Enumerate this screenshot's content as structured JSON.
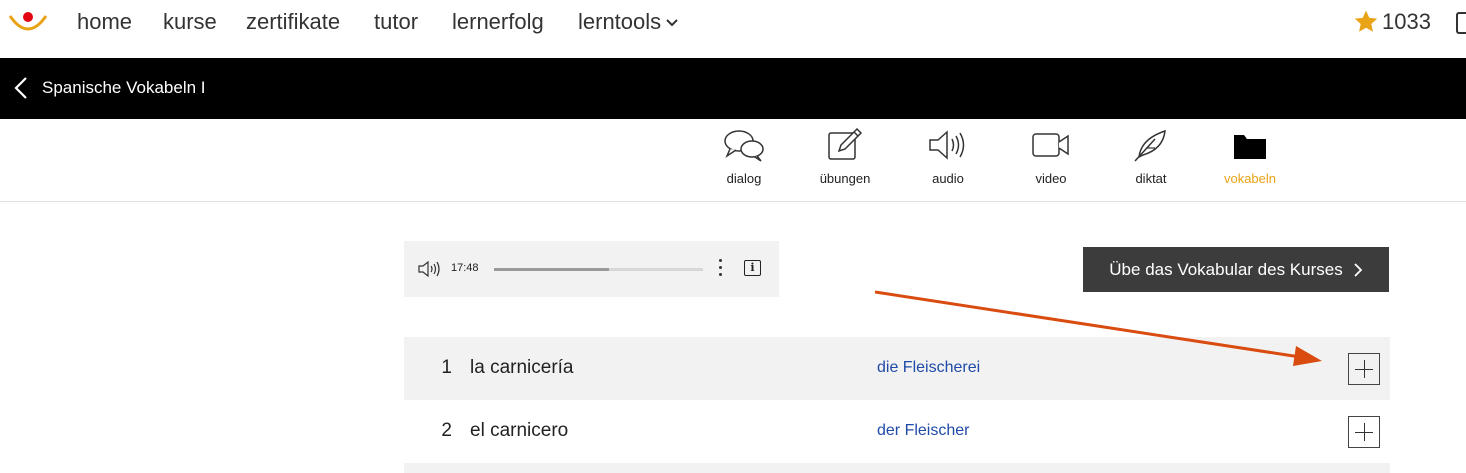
{
  "nav": {
    "items": [
      "home",
      "kurse",
      "zertifikate",
      "tutor",
      "lernerfolg",
      "lerntools"
    ],
    "points": "1033"
  },
  "course": {
    "title": "Spanische Vokabeln I"
  },
  "tabs": [
    {
      "label": "dialog",
      "icon": "speech-bubbles-icon"
    },
    {
      "label": "übungen",
      "icon": "pencil-icon"
    },
    {
      "label": "audio",
      "icon": "speaker-icon"
    },
    {
      "label": "video",
      "icon": "video-camera-icon"
    },
    {
      "label": "diktat",
      "icon": "feather-icon"
    },
    {
      "label": "vokabeln",
      "icon": "folder-icon",
      "active": true
    }
  ],
  "player": {
    "duration": "17:48",
    "progress": 0.55
  },
  "practice_button": {
    "label": "Übe das Vokabular des Kurses"
  },
  "vocab": [
    {
      "num": "1",
      "term": "la carnicería",
      "translation": "die Fleischerei"
    },
    {
      "num": "2",
      "term": "el carnicero",
      "translation": "der Fleischer"
    }
  ],
  "colors": {
    "accent": "#e8a317",
    "link": "#1f4aa8",
    "arrow": "#d94b0e",
    "logo_red": "#e30613"
  }
}
